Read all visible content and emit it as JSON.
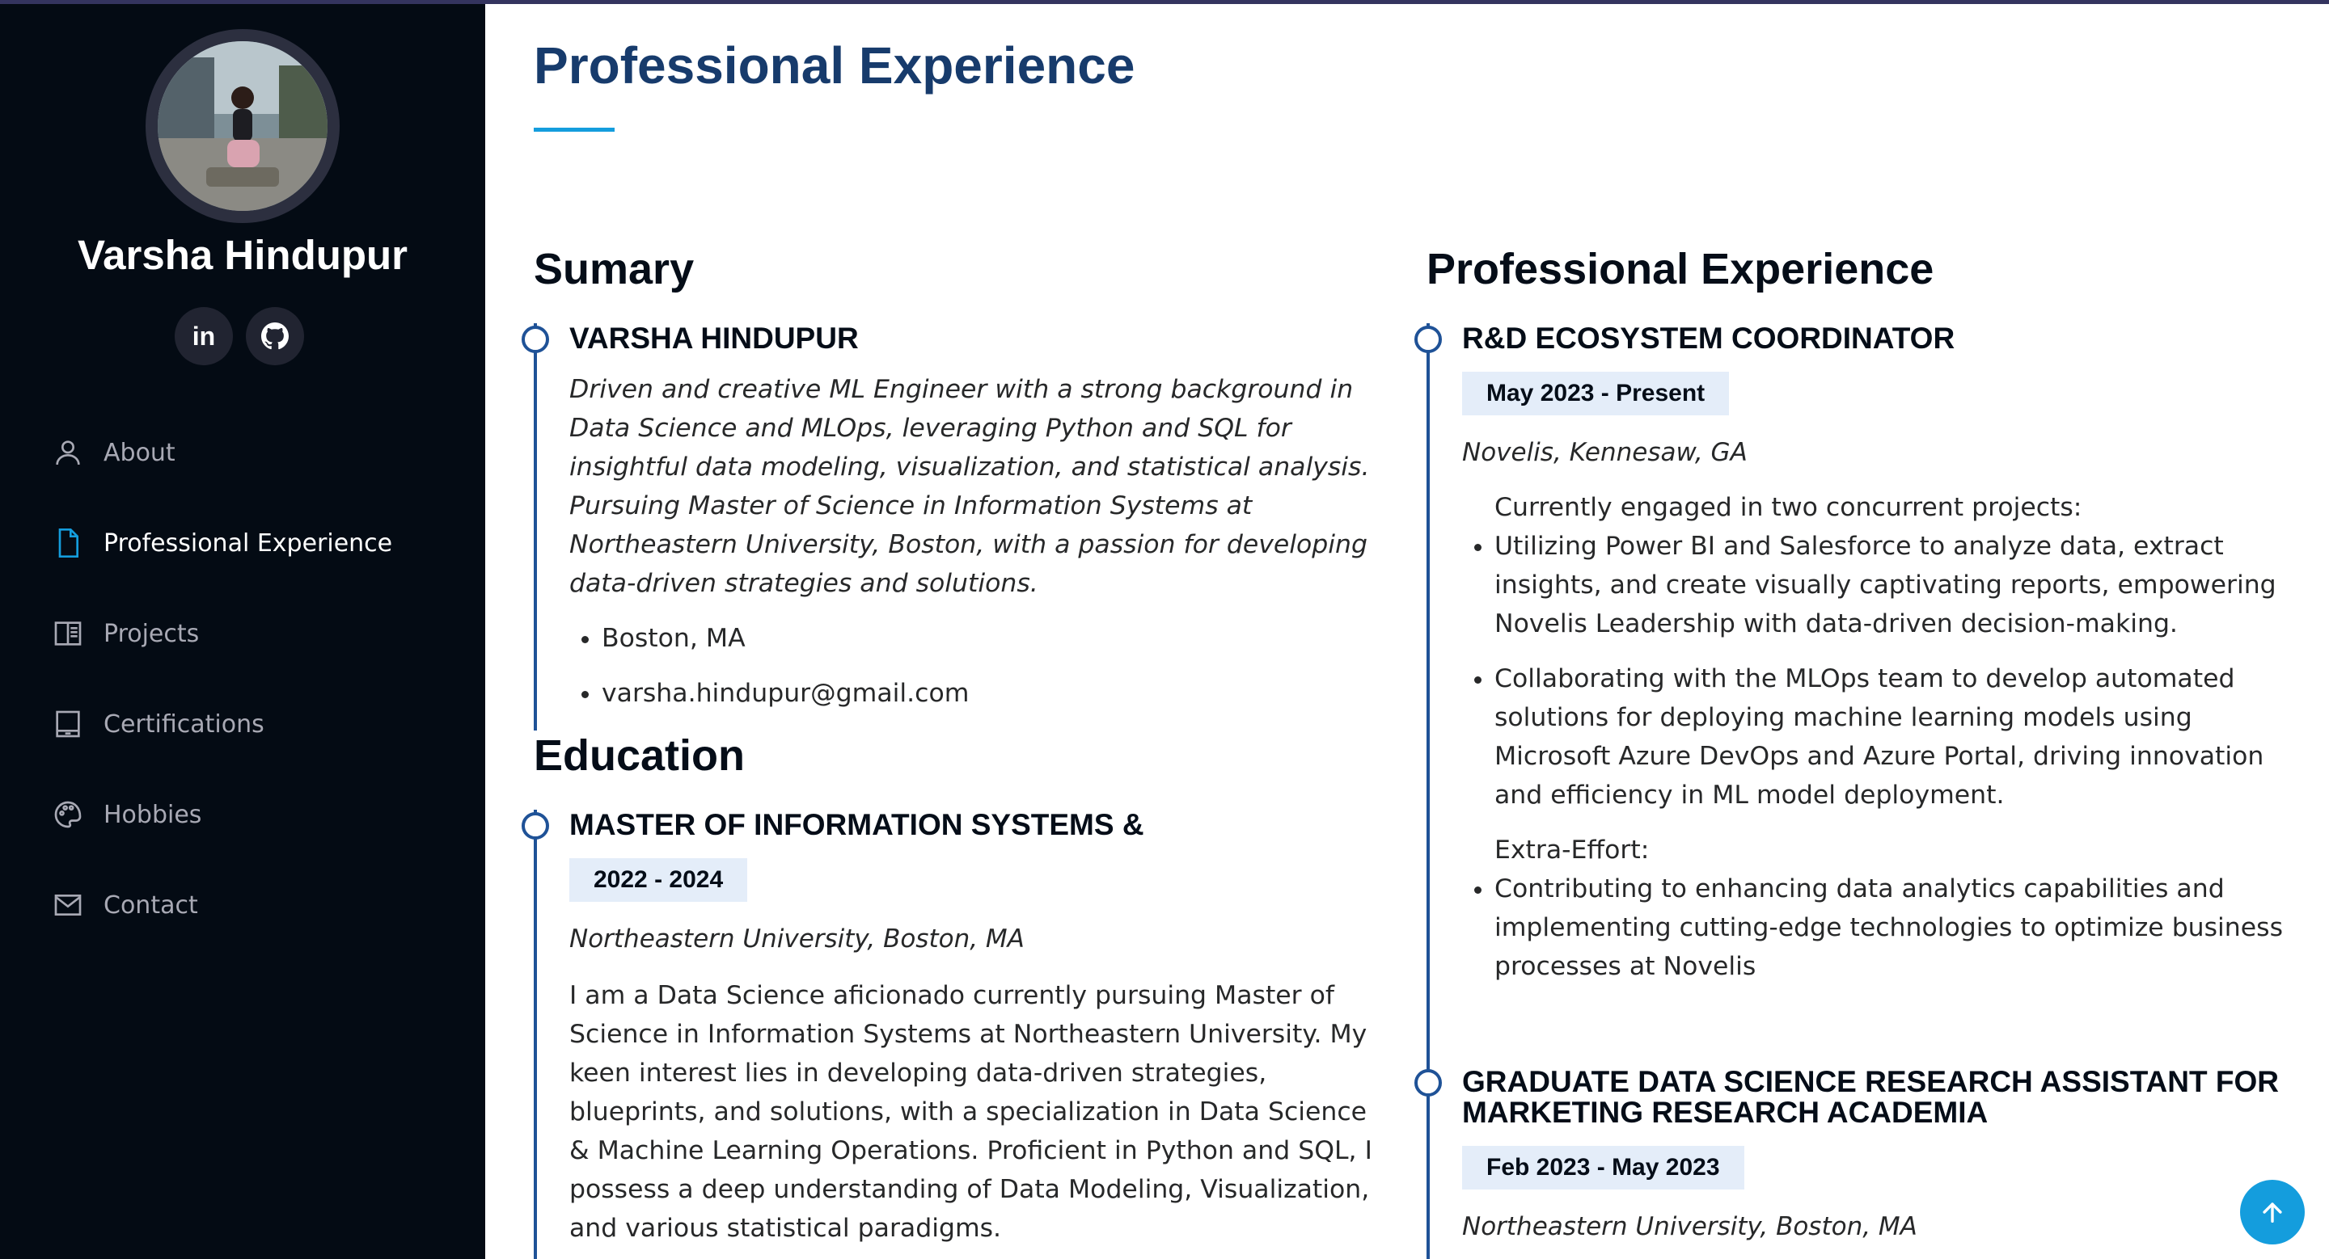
{
  "colors": {
    "sidebar_bg": "#040b14",
    "accent": "#149ddd",
    "title": "#173b6c",
    "timeline": "#1f5297",
    "date_bg": "#e4edf9"
  },
  "profile": {
    "name": "Varsha Hindupur",
    "avatar_icon": "profile-photo"
  },
  "social": {
    "linkedin": {
      "icon": "linkedin-icon",
      "text": "in"
    },
    "github": {
      "icon": "github-icon"
    }
  },
  "nav": [
    {
      "label": "About",
      "icon": "person-icon",
      "active": false
    },
    {
      "label": "Professional Experience",
      "icon": "file-icon",
      "active": true
    },
    {
      "label": "Projects",
      "icon": "book-half-icon",
      "active": false
    },
    {
      "label": "Certifications",
      "icon": "tablet-icon",
      "active": false
    },
    {
      "label": "Hobbies",
      "icon": "palette-icon",
      "active": false
    },
    {
      "label": "Contact",
      "icon": "envelope-icon",
      "active": false
    }
  ],
  "page": {
    "title": "Professional Experience"
  },
  "summary": {
    "heading": "Sumary",
    "name": "VARSHA HINDUPUR",
    "text": "Driven and creative ML Engineer with a strong background in Data Science and MLOps, leveraging Python and SQL for insightful data modeling, visualization, and statistical analysis. Pursuing Master of Science in Information Systems at Northeastern University, Boston, with a passion for developing data-driven strategies and solutions.",
    "location": "Boston, MA",
    "email": "varsha.hindupur@gmail.com"
  },
  "education": {
    "heading": "Education",
    "degree": "MASTER OF INFORMATION SYSTEMS &",
    "date": "2022 - 2024",
    "org": "Northeastern University, Boston, MA",
    "text": "I am a Data Science aficionado currently pursuing Master of Science in Information Systems at Northeastern University. My keen interest lies in developing data-driven strategies, blueprints, and solutions, with a specialization in Data Science & Machine Learning Operations. Proficient in Python and SQL, I possess a deep understanding of Data Modeling, Visualization, and various statistical paradigms."
  },
  "experience": {
    "heading": "Professional Experience",
    "jobs": [
      {
        "title": "R&D ECOSYSTEM COORDINATOR",
        "date": "May 2023 - Present",
        "org": "Novelis, Kennesaw, GA",
        "intro": "Currently engaged in two concurrent projects:",
        "bullets": [
          "Utilizing Power BI and Salesforce to analyze data, extract insights, and create visually captivating reports, empowering Novelis Leadership with data-driven decision-making.",
          "Collaborating with the MLOps team to develop automated solutions for deploying machine learning models using Microsoft Azure DevOps and Azure Portal, driving innovation and efficiency in ML model deployment."
        ],
        "extra_label": "Extra-Effort:",
        "extra_bullets": [
          "Contributing to enhancing data analytics capabilities and implementing cutting-edge technologies to optimize business processes at Novelis"
        ]
      },
      {
        "title": "GRADUATE DATA SCIENCE RESEARCH ASSISTANT FOR MARKETING RESEARCH ACADEMIA",
        "date": "Feb 2023 - May 2023",
        "org": "Northeastern University, Boston, MA"
      }
    ]
  },
  "back_to_top": {
    "icon": "arrow-up-icon"
  }
}
